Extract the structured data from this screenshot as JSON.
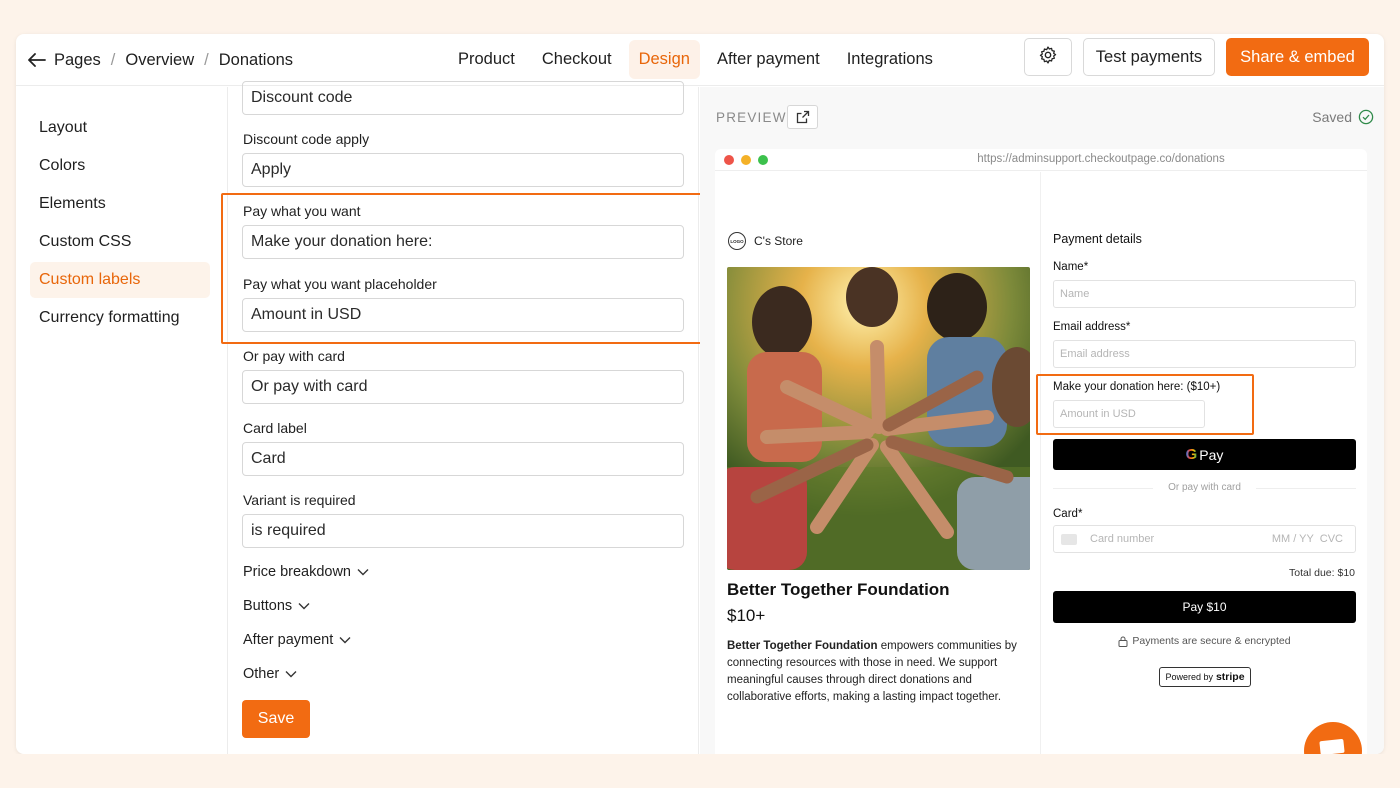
{
  "breadcrumb": {
    "items": [
      "Pages",
      "Overview",
      "Donations"
    ]
  },
  "tabs": [
    "Product",
    "Checkout",
    "Design",
    "After payment",
    "Integrations"
  ],
  "active_tab": "Design",
  "header": {
    "test_label": "Test payments",
    "share_label": "Share & embed"
  },
  "nav": {
    "items": [
      "Layout",
      "Colors",
      "Elements",
      "Custom CSS",
      "Custom labels",
      "Currency formatting"
    ],
    "active": "Custom labels"
  },
  "form": {
    "discount_code_value": "Discount code",
    "fields": [
      {
        "label": "Discount code apply",
        "value": "Apply"
      },
      {
        "label": "Pay what you want",
        "value": "Make your donation here:"
      },
      {
        "label": "Pay what you want placeholder",
        "value": "Amount in USD"
      },
      {
        "label": "Or pay with card",
        "value": "Or pay with card"
      },
      {
        "label": "Card label",
        "value": "Card"
      },
      {
        "label": "Variant is required",
        "value": "is required"
      }
    ],
    "collapsibles": [
      "Price breakdown",
      "Buttons",
      "After payment",
      "Other"
    ],
    "save_label": "Save"
  },
  "preview": {
    "label": "PREVIEW",
    "saved_label": "Saved",
    "url": "https://adminsupport.checkoutpage.co/donations",
    "store_name": "C's Store",
    "logo_text": "LOGO",
    "product_title": "Better Together Foundation",
    "price": "$10+",
    "description_bold": "Better Together Foundation",
    "description_rest": " empowers communities by connecting resources with those in need. We support meaningful causes through direct donations and collaborative efforts, making a lasting impact together.",
    "payment_details": "Payment details",
    "name_label": "Name",
    "name_placeholder": "Name",
    "email_label": "Email address",
    "email_placeholder": "Email address",
    "donation_label": "Make your donation here: ($10+)",
    "donation_placeholder": "Amount in USD",
    "gpay_label": "Pay",
    "or_card": "Or pay with card",
    "card_label": "Card",
    "card_number": "Card number",
    "card_exp_cvc": "MM / YY  CVC",
    "total": "Total due: $10",
    "pay_button": "Pay $10",
    "secure_text": "Payments are secure & encrypted",
    "powered_by": "Powered by",
    "stripe": "stripe",
    "required_mark": "*"
  },
  "colors": {
    "accent": "#f26b12",
    "accent_text": "#e8660a",
    "accent_bg": "#fdf3ea"
  }
}
